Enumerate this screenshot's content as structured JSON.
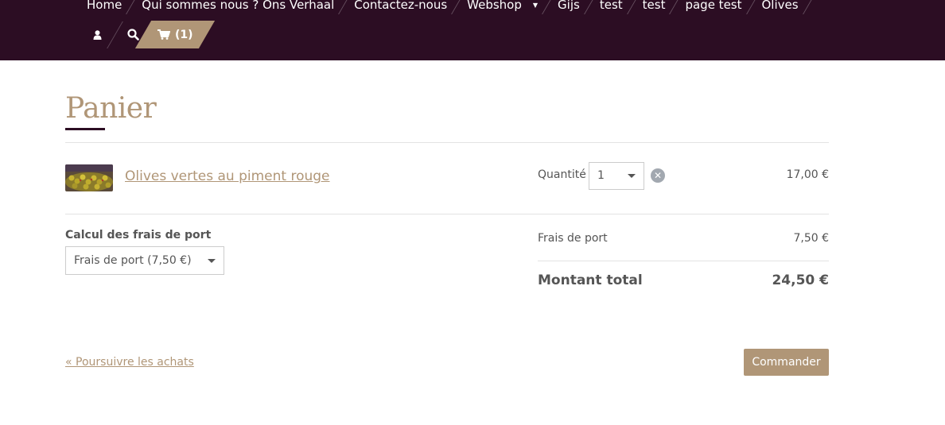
{
  "header": {
    "nav": [
      {
        "label": "Home"
      },
      {
        "label": "Qui sommes nous ? Ons Verhaal"
      },
      {
        "label": "Contactez-nous"
      },
      {
        "label": "Webshop",
        "has_dropdown": true
      },
      {
        "label": "Gijs"
      },
      {
        "label": "test"
      },
      {
        "label": "test"
      },
      {
        "label": "page test"
      },
      {
        "label": "Olives"
      }
    ],
    "utility": {
      "account_icon": "user-icon",
      "search_icon": "search-icon",
      "cart_icon": "shopping-cart-icon",
      "cart_count": "(1)"
    }
  },
  "page": {
    "title": "Panier"
  },
  "cart": {
    "items": [
      {
        "name": "Olives vertes au piment rouge",
        "quantity_label": "Quantité",
        "quantity": "1",
        "price": "17,00 €"
      }
    ]
  },
  "shipping": {
    "title": "Calcul des frais de port",
    "selected": "Frais de port (7,50 €)"
  },
  "summary": {
    "shipping_label": "Frais de port",
    "shipping_value": "7,50 €",
    "total_label": "Montant total",
    "total_value": "24,50 €"
  },
  "actions": {
    "continue": "« Poursuivre les achats",
    "order": "Commander"
  },
  "colors": {
    "header_bg": "#2c0d23",
    "accent": "#b09677",
    "text": "#555555",
    "remove_icon": "#a2a8b0"
  }
}
